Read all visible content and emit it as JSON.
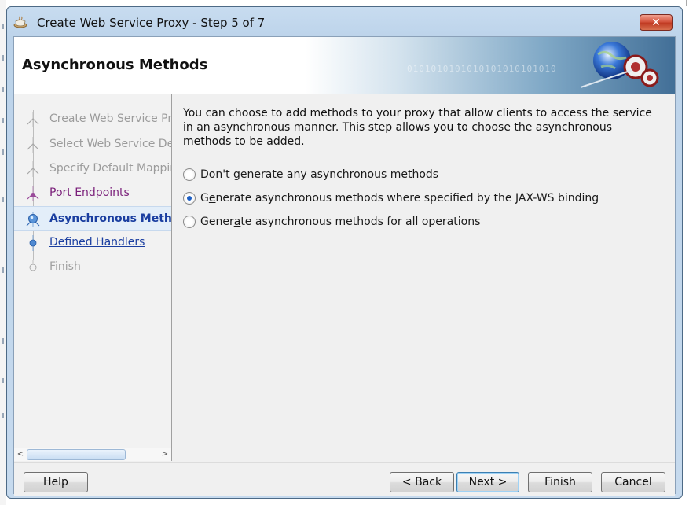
{
  "window": {
    "title": "Create Web Service Proxy - Step 5 of 7",
    "close_glyph": "✕",
    "app_icon": "coffee-cup-icon"
  },
  "banner": {
    "title": "Asynchronous Methods",
    "decoration_text": "0101010101010101010101010"
  },
  "steps": [
    {
      "label": "Create Web Service Proxy",
      "state": "done"
    },
    {
      "label": "Select Web Service Description",
      "state": "done"
    },
    {
      "label": "Specify Default Mapping Options",
      "state": "done"
    },
    {
      "label": "Port Endpoints",
      "state": "visited"
    },
    {
      "label": "Asynchronous Methods",
      "state": "current"
    },
    {
      "label": "Defined Handlers",
      "state": "link"
    },
    {
      "label": "Finish",
      "state": "future"
    }
  ],
  "content": {
    "description": "You can choose to add methods to your proxy that allow clients to access the service in an asynchronous manner. This step allows you to choose the asynchronous methods to be added.",
    "options": [
      {
        "label": "Don't generate any asynchronous methods",
        "mnemonic": "D",
        "checked": false
      },
      {
        "label": "Generate asynchronous methods where specified by the JAX-WS binding",
        "mnemonic": "e",
        "checked": true
      },
      {
        "label": "Generate asynchronous methods for all operations",
        "mnemonic": "a",
        "checked": false
      }
    ]
  },
  "buttons": {
    "help": "Help",
    "back": "< Back",
    "next": "Next >",
    "finish": "Finish",
    "cancel": "Cancel"
  },
  "scrollbar": {
    "left_arrow": "<",
    "right_arrow": ">"
  },
  "colors": {
    "accent_blue": "#1a3ea0",
    "visited_purple": "#7a1f7a",
    "close_red": "#c94a33"
  }
}
